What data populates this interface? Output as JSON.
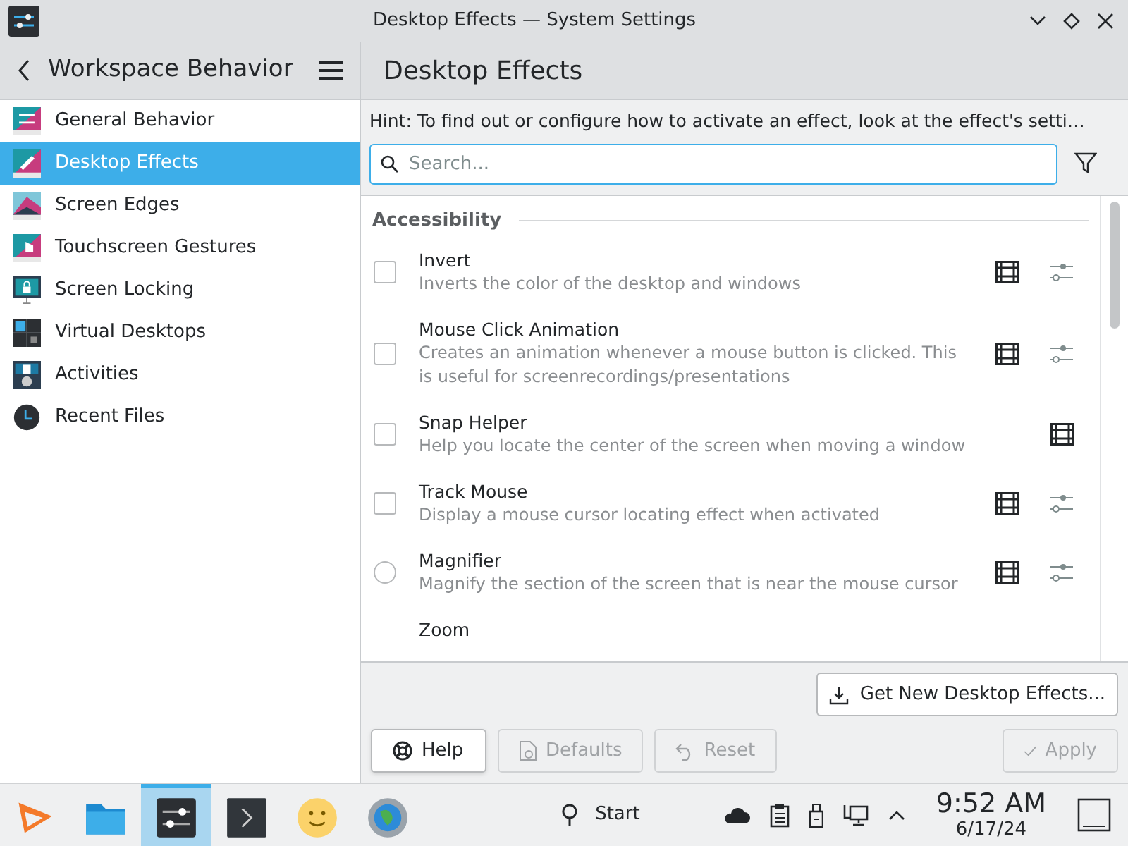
{
  "window": {
    "title": "Desktop Effects — System Settings"
  },
  "sidebar": {
    "title": "Workspace Behavior",
    "items": [
      {
        "label": "General Behavior",
        "selected": false,
        "kind": "general"
      },
      {
        "label": "Desktop Effects",
        "selected": true,
        "kind": "effects"
      },
      {
        "label": "Screen Edges",
        "selected": false,
        "kind": "edges"
      },
      {
        "label": "Touchscreen Gestures",
        "selected": false,
        "kind": "touch"
      },
      {
        "label": "Screen Locking",
        "selected": false,
        "kind": "lock"
      },
      {
        "label": "Virtual Desktops",
        "selected": false,
        "kind": "desktops"
      },
      {
        "label": "Activities",
        "selected": false,
        "kind": "activities"
      },
      {
        "label": "Recent Files",
        "selected": false,
        "kind": "recent"
      }
    ]
  },
  "page": {
    "title": "Desktop Effects",
    "hint": "Hint: To find out or configure how to activate an effect, look at the effect's setti…",
    "search": {
      "placeholder": "Search..."
    },
    "section": "Accessibility",
    "effects": [
      {
        "name": "Invert",
        "description": "Inverts the color of the desktop and windows",
        "kind": "checkbox",
        "checked": false,
        "video": true,
        "configurable": true
      },
      {
        "name": "Mouse Click Animation",
        "description": "Creates an animation whenever a mouse button is clicked. This is useful for screenrecordings/presentations",
        "kind": "checkbox",
        "checked": false,
        "video": true,
        "configurable": true
      },
      {
        "name": "Snap Helper",
        "description": "Help you locate the center of the screen when moving a window",
        "kind": "checkbox",
        "checked": false,
        "video": true,
        "configurable": false
      },
      {
        "name": "Track Mouse",
        "description": "Display a mouse cursor locating effect when activated",
        "kind": "checkbox",
        "checked": false,
        "video": true,
        "configurable": true
      },
      {
        "name": "Magnifier",
        "description": "Magnify the section of the screen that is near the mouse cursor",
        "kind": "radio",
        "checked": false,
        "video": true,
        "configurable": true
      },
      {
        "name": "Zoom"
      }
    ],
    "get_new": "Get New Desktop Effects...",
    "buttons": [
      {
        "label": "Help",
        "kind": "help",
        "disabled": false
      },
      {
        "label": "Defaults",
        "kind": "defaults",
        "disabled": true
      },
      {
        "label": "Reset",
        "kind": "reset",
        "disabled": true
      },
      {
        "label": "Apply",
        "kind": "apply",
        "disabled": true
      }
    ]
  },
  "taskbar": {
    "apps": [
      {
        "kind": "launcher",
        "selected": false
      },
      {
        "kind": "files",
        "selected": false
      },
      {
        "kind": "settings",
        "selected": true
      },
      {
        "kind": "terminal",
        "selected": false
      },
      {
        "kind": "smiley",
        "selected": false
      },
      {
        "kind": "globe",
        "selected": false
      }
    ],
    "start": "Start",
    "time": "9:52 AM",
    "date": "6/17/24"
  }
}
